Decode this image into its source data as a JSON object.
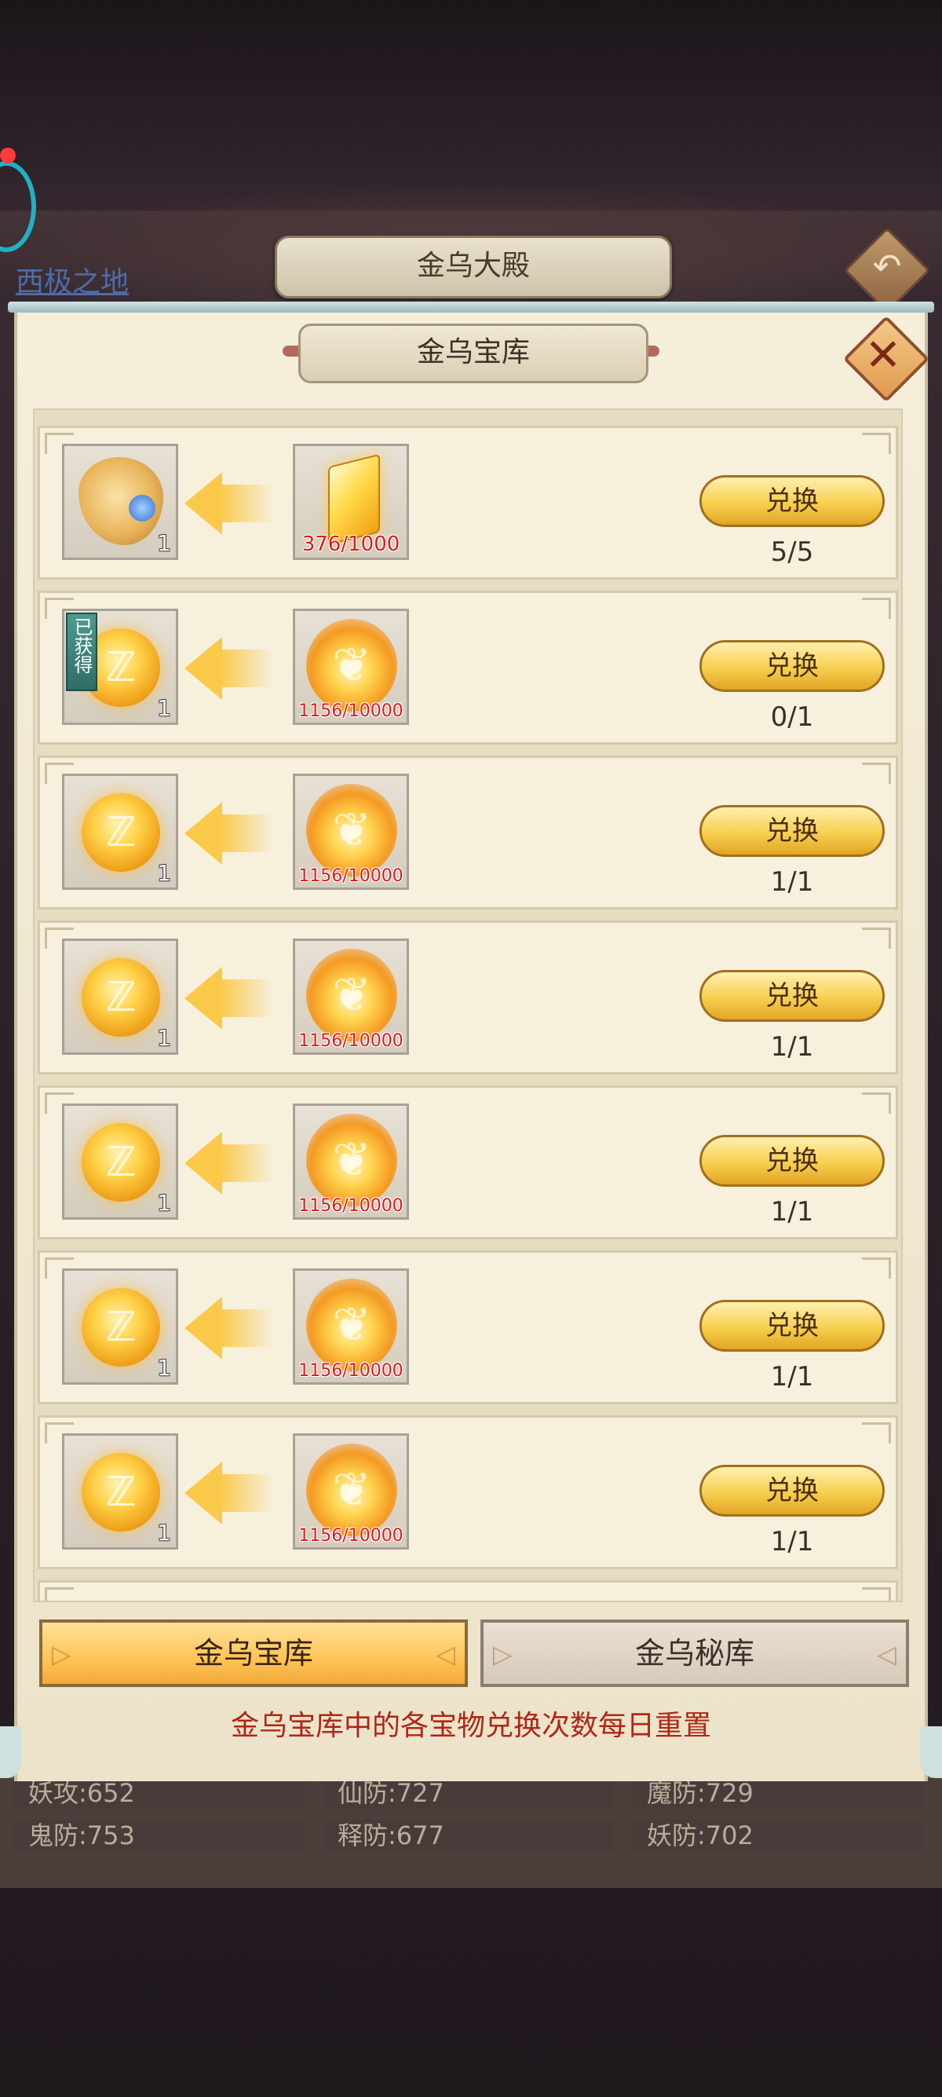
{
  "hall": {
    "title": "金乌大殿",
    "region": "西极之地"
  },
  "panel": {
    "title": "金乌宝库"
  },
  "rows": [
    {
      "reward_type": "pendant",
      "reward_qty": "1",
      "obtained": false,
      "cost_type": "crystal",
      "cost_count": "376/1000",
      "button": "兑换",
      "count": "5/5"
    },
    {
      "reward_type": "coin",
      "reward_qty": "1",
      "obtained": true,
      "badge": "已获得",
      "cost_type": "phoenix",
      "cost_count": "1156/10000",
      "button": "兑换",
      "count": "0/1"
    },
    {
      "reward_type": "coin",
      "reward_qty": "1",
      "obtained": false,
      "cost_type": "phoenix",
      "cost_count": "1156/10000",
      "button": "兑换",
      "count": "1/1"
    },
    {
      "reward_type": "coin",
      "reward_qty": "1",
      "obtained": false,
      "cost_type": "phoenix",
      "cost_count": "1156/10000",
      "button": "兑换",
      "count": "1/1"
    },
    {
      "reward_type": "coin",
      "reward_qty": "1",
      "obtained": false,
      "cost_type": "phoenix",
      "cost_count": "1156/10000",
      "button": "兑换",
      "count": "1/1"
    },
    {
      "reward_type": "coin",
      "reward_qty": "1",
      "obtained": false,
      "cost_type": "phoenix",
      "cost_count": "1156/10000",
      "button": "兑换",
      "count": "1/1"
    },
    {
      "reward_type": "coin",
      "reward_qty": "1",
      "obtained": false,
      "cost_type": "phoenix",
      "cost_count": "1156/10000",
      "button": "兑换",
      "count": "1/1"
    }
  ],
  "tabs": [
    {
      "label": "金乌宝库",
      "active": true
    },
    {
      "label": "金乌秘库",
      "active": false
    }
  ],
  "note": "金乌宝库中的各宝物兑换次数每日重置",
  "stats": [
    "妖攻:652",
    "仙防:727",
    "魔防:729",
    "鬼防:753",
    "释防:677",
    "妖防:702"
  ]
}
